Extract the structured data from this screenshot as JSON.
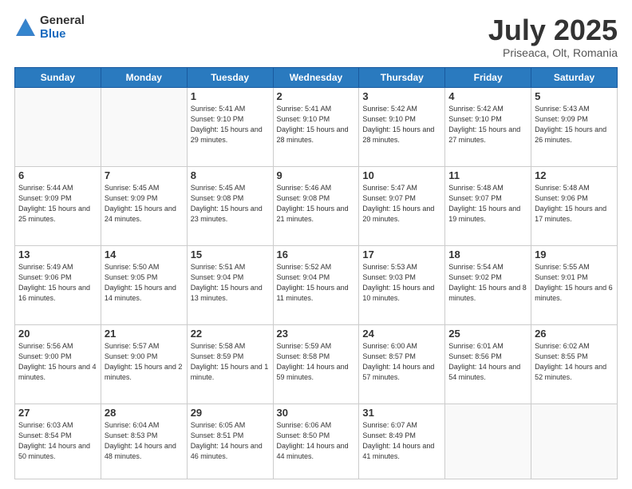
{
  "logo": {
    "general": "General",
    "blue": "Blue"
  },
  "title": "July 2025",
  "subtitle": "Priseaca, Olt, Romania",
  "days_of_week": [
    "Sunday",
    "Monday",
    "Tuesday",
    "Wednesday",
    "Thursday",
    "Friday",
    "Saturday"
  ],
  "weeks": [
    [
      {
        "day": "",
        "info": ""
      },
      {
        "day": "",
        "info": ""
      },
      {
        "day": "1",
        "info": "Sunrise: 5:41 AM\nSunset: 9:10 PM\nDaylight: 15 hours\nand 29 minutes."
      },
      {
        "day": "2",
        "info": "Sunrise: 5:41 AM\nSunset: 9:10 PM\nDaylight: 15 hours\nand 28 minutes."
      },
      {
        "day": "3",
        "info": "Sunrise: 5:42 AM\nSunset: 9:10 PM\nDaylight: 15 hours\nand 28 minutes."
      },
      {
        "day": "4",
        "info": "Sunrise: 5:42 AM\nSunset: 9:10 PM\nDaylight: 15 hours\nand 27 minutes."
      },
      {
        "day": "5",
        "info": "Sunrise: 5:43 AM\nSunset: 9:09 PM\nDaylight: 15 hours\nand 26 minutes."
      }
    ],
    [
      {
        "day": "6",
        "info": "Sunrise: 5:44 AM\nSunset: 9:09 PM\nDaylight: 15 hours\nand 25 minutes."
      },
      {
        "day": "7",
        "info": "Sunrise: 5:45 AM\nSunset: 9:09 PM\nDaylight: 15 hours\nand 24 minutes."
      },
      {
        "day": "8",
        "info": "Sunrise: 5:45 AM\nSunset: 9:08 PM\nDaylight: 15 hours\nand 23 minutes."
      },
      {
        "day": "9",
        "info": "Sunrise: 5:46 AM\nSunset: 9:08 PM\nDaylight: 15 hours\nand 21 minutes."
      },
      {
        "day": "10",
        "info": "Sunrise: 5:47 AM\nSunset: 9:07 PM\nDaylight: 15 hours\nand 20 minutes."
      },
      {
        "day": "11",
        "info": "Sunrise: 5:48 AM\nSunset: 9:07 PM\nDaylight: 15 hours\nand 19 minutes."
      },
      {
        "day": "12",
        "info": "Sunrise: 5:48 AM\nSunset: 9:06 PM\nDaylight: 15 hours\nand 17 minutes."
      }
    ],
    [
      {
        "day": "13",
        "info": "Sunrise: 5:49 AM\nSunset: 9:06 PM\nDaylight: 15 hours\nand 16 minutes."
      },
      {
        "day": "14",
        "info": "Sunrise: 5:50 AM\nSunset: 9:05 PM\nDaylight: 15 hours\nand 14 minutes."
      },
      {
        "day": "15",
        "info": "Sunrise: 5:51 AM\nSunset: 9:04 PM\nDaylight: 15 hours\nand 13 minutes."
      },
      {
        "day": "16",
        "info": "Sunrise: 5:52 AM\nSunset: 9:04 PM\nDaylight: 15 hours\nand 11 minutes."
      },
      {
        "day": "17",
        "info": "Sunrise: 5:53 AM\nSunset: 9:03 PM\nDaylight: 15 hours\nand 10 minutes."
      },
      {
        "day": "18",
        "info": "Sunrise: 5:54 AM\nSunset: 9:02 PM\nDaylight: 15 hours\nand 8 minutes."
      },
      {
        "day": "19",
        "info": "Sunrise: 5:55 AM\nSunset: 9:01 PM\nDaylight: 15 hours\nand 6 minutes."
      }
    ],
    [
      {
        "day": "20",
        "info": "Sunrise: 5:56 AM\nSunset: 9:00 PM\nDaylight: 15 hours\nand 4 minutes."
      },
      {
        "day": "21",
        "info": "Sunrise: 5:57 AM\nSunset: 9:00 PM\nDaylight: 15 hours\nand 2 minutes."
      },
      {
        "day": "22",
        "info": "Sunrise: 5:58 AM\nSunset: 8:59 PM\nDaylight: 15 hours\nand 1 minute."
      },
      {
        "day": "23",
        "info": "Sunrise: 5:59 AM\nSunset: 8:58 PM\nDaylight: 14 hours\nand 59 minutes."
      },
      {
        "day": "24",
        "info": "Sunrise: 6:00 AM\nSunset: 8:57 PM\nDaylight: 14 hours\nand 57 minutes."
      },
      {
        "day": "25",
        "info": "Sunrise: 6:01 AM\nSunset: 8:56 PM\nDaylight: 14 hours\nand 54 minutes."
      },
      {
        "day": "26",
        "info": "Sunrise: 6:02 AM\nSunset: 8:55 PM\nDaylight: 14 hours\nand 52 minutes."
      }
    ],
    [
      {
        "day": "27",
        "info": "Sunrise: 6:03 AM\nSunset: 8:54 PM\nDaylight: 14 hours\nand 50 minutes."
      },
      {
        "day": "28",
        "info": "Sunrise: 6:04 AM\nSunset: 8:53 PM\nDaylight: 14 hours\nand 48 minutes."
      },
      {
        "day": "29",
        "info": "Sunrise: 6:05 AM\nSunset: 8:51 PM\nDaylight: 14 hours\nand 46 minutes."
      },
      {
        "day": "30",
        "info": "Sunrise: 6:06 AM\nSunset: 8:50 PM\nDaylight: 14 hours\nand 44 minutes."
      },
      {
        "day": "31",
        "info": "Sunrise: 6:07 AM\nSunset: 8:49 PM\nDaylight: 14 hours\nand 41 minutes."
      },
      {
        "day": "",
        "info": ""
      },
      {
        "day": "",
        "info": ""
      }
    ]
  ]
}
